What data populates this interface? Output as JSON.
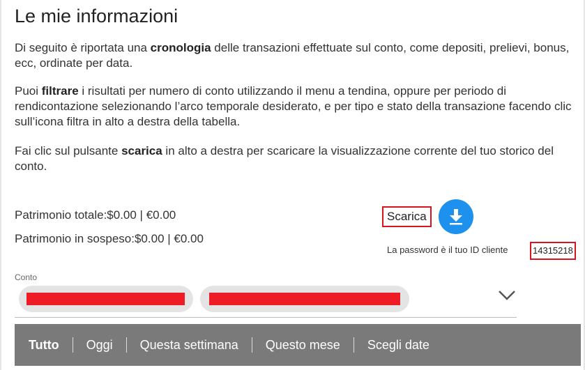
{
  "page": {
    "title": "Le mie informazioni",
    "para1": {
      "pre": "Di seguito è riportata una ",
      "bold": "cronologia",
      "post": " delle transazioni effettuate sul conto, come depositi, prelievi, bonus, ecc, ordinate per data."
    },
    "para2": {
      "pre": "Puoi ",
      "bold": "filtrare",
      "post": " i risultati per numero di conto utilizzando il menu a tendina, oppure per periodo di rendicontazione selezionando l’arco temporale desiderato, e per tipo e stato della transazione facendo clic sull’icona filtra in alto a destra della tabella."
    },
    "para3": {
      "pre": "Fai clic sul pulsante ",
      "bold": "scarica",
      "post": " in alto a destra per scaricare la visualizzazione corrente del tuo storico del conto."
    }
  },
  "assets": {
    "total": "Patrimonio totale:$0.00 | €0.00",
    "pending": "Patrimonio in sospeso:$0.00 | €0.00"
  },
  "download": {
    "label": "Scarica",
    "icon": "download-icon",
    "button_color": "#1e90ee"
  },
  "password": {
    "text": "La password è il tuo ID cliente",
    "client_id": "14315218"
  },
  "account": {
    "label": "Conto",
    "icon": "chevron-down-icon"
  },
  "tabs": [
    "Tutto",
    "Oggi",
    "Questa settimana",
    "Questo mese",
    "Scegli date"
  ],
  "colors": {
    "highlight_border": "#d8141e",
    "redaction": "#ee1c25",
    "tabbar_bg": "#7a7a7a"
  }
}
